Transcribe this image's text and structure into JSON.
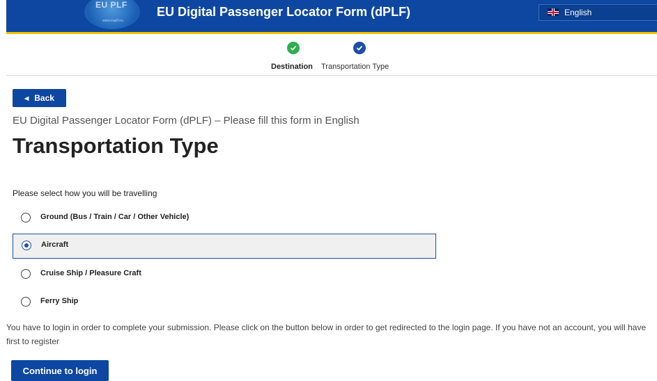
{
  "header": {
    "logo_text": "EU PLF",
    "logo_subtext": "www.euplf.eu",
    "title": "EU Digital Passenger Locator Form (dPLF)",
    "language": "English",
    "accent_color": "#0d47a1",
    "underline_color": "#f2c200"
  },
  "stepper": {
    "steps": [
      {
        "label": "Destination",
        "status": "completed",
        "color": "#2eae4f"
      },
      {
        "label": "Transportation Type",
        "status": "current",
        "color": "#1d4fa8"
      }
    ]
  },
  "main": {
    "back_label": "Back",
    "subtitle": "EU Digital Passenger Locator Form (dPLF) – Please fill this form in English",
    "title": "Transportation Type",
    "prompt": "Please select how you will be travelling",
    "options": [
      {
        "label": "Ground (Bus / Train / Car / Other Vehicle)",
        "selected": false
      },
      {
        "label": "Aircraft",
        "selected": true
      },
      {
        "label": "Cruise Ship / Pleasure Craft",
        "selected": false
      },
      {
        "label": "Ferry Ship",
        "selected": false
      }
    ],
    "notice": "You have to login in order to complete your submission. Please click on the button below in order to get redirected to the login page. If you have not an account, you will have first to register",
    "login_label": "Continue to login"
  }
}
